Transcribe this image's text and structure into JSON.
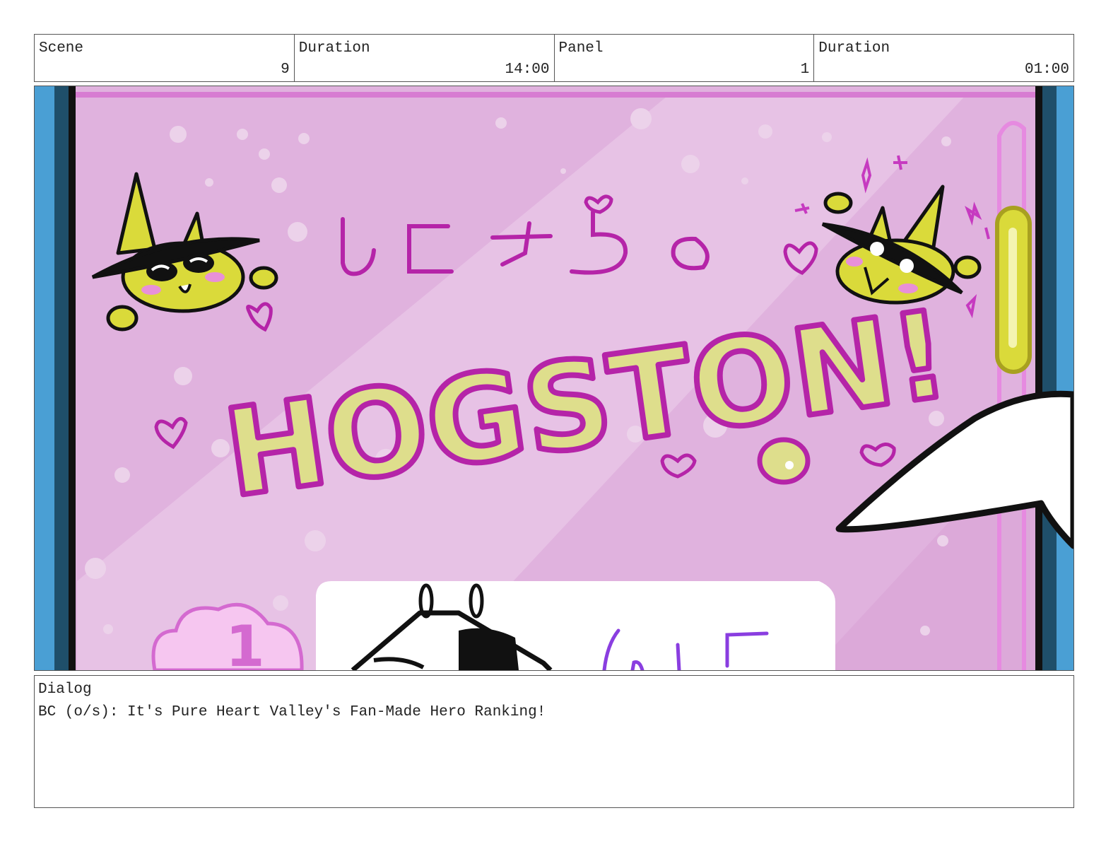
{
  "header": {
    "scene_label": "Scene",
    "scene_value": "9",
    "scene_duration_label": "Duration",
    "scene_duration_value": "14:00",
    "panel_label": "Panel",
    "panel_value": "1",
    "panel_duration_label": "Duration",
    "panel_duration_value": "01:00"
  },
  "artwork": {
    "banner_text": "HOGSTON!",
    "colors": {
      "background": "#e0b2de",
      "outline": "#b524a8",
      "yellow": "#dada3a",
      "frame_blue": "#4a9fd4"
    }
  },
  "dialog": {
    "label": "Dialog",
    "text": "BC (o/s): It's Pure Heart Valley's Fan-Made Hero Ranking!"
  }
}
